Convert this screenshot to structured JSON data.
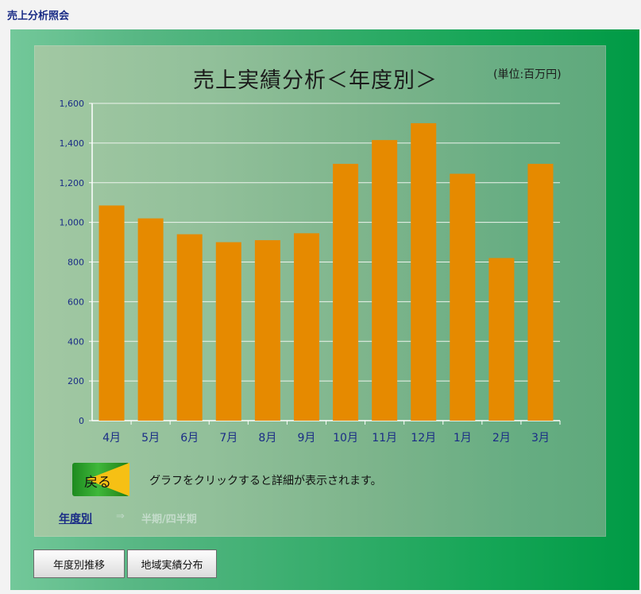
{
  "app": {
    "title": "売上分析照会"
  },
  "chart_data": {
    "type": "bar",
    "title": "売上実績分析＜年度別＞",
    "unit_label": "(単位:百万円)",
    "categories": [
      "4月",
      "5月",
      "6月",
      "7月",
      "8月",
      "9月",
      "10月",
      "11月",
      "12月",
      "1月",
      "2月",
      "3月"
    ],
    "values": [
      1085,
      1020,
      940,
      900,
      910,
      945,
      1295,
      1415,
      1500,
      1245,
      820,
      1295
    ],
    "ylim": [
      0,
      1600
    ],
    "yticks": [
      "0",
      "200",
      "400",
      "600",
      "800",
      "1,000",
      "1,200",
      "1,400",
      "1,600"
    ],
    "grid": true,
    "bar_color": "#e68a00"
  },
  "controls": {
    "back_label": "戻る",
    "hint": "グラフをクリックすると詳細が表示されます。"
  },
  "breadcrumb": {
    "current": "年度別",
    "separator": "⇒",
    "next": "半期/四半期"
  },
  "buttons": {
    "yearly_trend": "年度別推移",
    "regional": "地域実績分布"
  }
}
